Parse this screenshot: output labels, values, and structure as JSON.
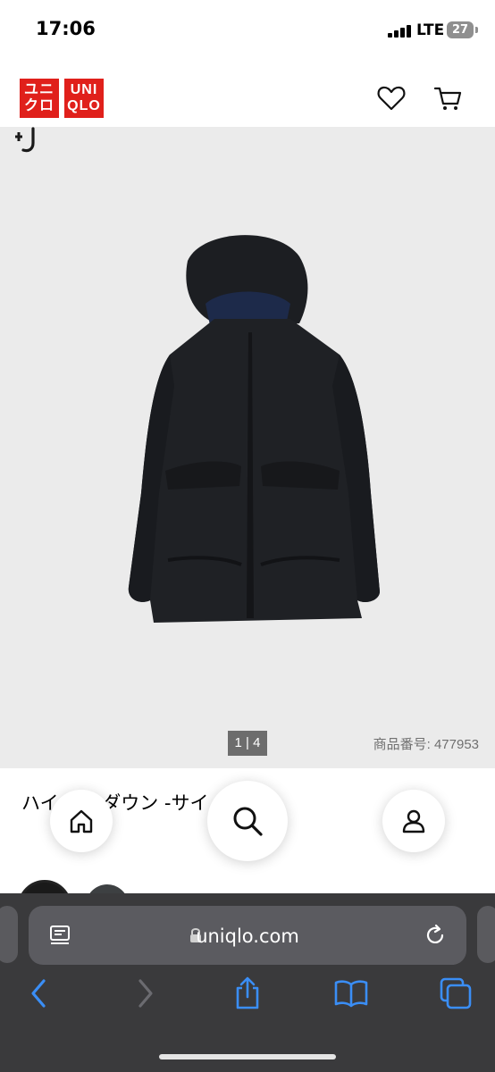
{
  "status_bar": {
    "time": "17:06",
    "network": "LTE",
    "battery": "27"
  },
  "header": {
    "logo_top": [
      "ユニ",
      "クロ"
    ],
    "logo_bottom": [
      "UNI",
      "QLO"
    ],
    "icons": [
      "heart-icon",
      "cart-icon"
    ]
  },
  "product": {
    "brand_mark": "+J",
    "pager": "1 | 4",
    "product_number": "商品番号: 477953",
    "title": "ハイ　　ッドダウン　　　　-サイ　　　　ズ　　　　　　　　　　　　　　　　　　ズ",
    "title_display": "ハイ ッドダウン -サイ ズ"
  },
  "floating_nav": {
    "icons": [
      "home-icon",
      "search-icon",
      "account-icon"
    ]
  },
  "browser": {
    "url": "uniqlo.com",
    "toolbar": [
      "back-icon",
      "forward-icon",
      "share-icon",
      "bookmarks-icon",
      "tabs-icon"
    ]
  },
  "colors": {
    "brand_red": "#e0201b",
    "ios_blue": "#3a8ef6",
    "toolbar_bg": "#3a3a3c"
  }
}
